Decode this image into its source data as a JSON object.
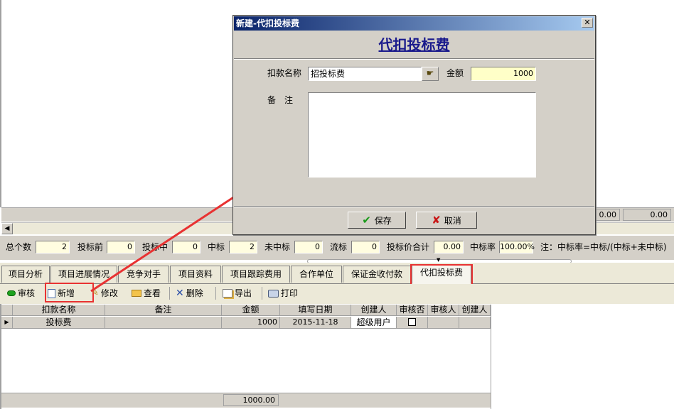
{
  "dialog": {
    "window_title": "新建-代扣投标费",
    "heading": "代扣投标费",
    "deduct_name_label": "扣款名称",
    "deduct_name_value": "招投标费",
    "amount_label": "金额",
    "amount_value": "1000",
    "note_label": "备　注",
    "note_value": "",
    "save_label": "保存",
    "cancel_label": "取消"
  },
  "background_panel": {
    "right_value_1": "0.00",
    "right_value_2": "0.00"
  },
  "stats": {
    "total_label": "总个数",
    "total_value": "2",
    "before_bid_label": "投标前",
    "before_bid_value": "0",
    "bidding_label": "投标中",
    "bidding_value": "0",
    "won_label": "中标",
    "won_value": "2",
    "lost_label": "未中标",
    "lost_value": "0",
    "failed_label": "流标",
    "failed_value": "0",
    "bid_price_total_label": "投标价合计",
    "bid_price_total_value": "0.00",
    "win_rate_label": "中标率",
    "win_rate_value": "100.00%",
    "note": "注：中标率=中标/(中标+未中标)"
  },
  "tabs": [
    "项目分析",
    "项目进展情况",
    "竞争对手",
    "项目资料",
    "项目跟踪费用",
    "合作单位",
    "保证金收付款",
    "代扣投标费"
  ],
  "active_tab": "代扣投标费",
  "toolbar": {
    "audit": "审核",
    "add": "新增",
    "edit": "修改",
    "view": "查看",
    "delete": "删除",
    "export": "导出",
    "print": "打印"
  },
  "table": {
    "columns": [
      "扣款名称",
      "备注",
      "金额",
      "填写日期",
      "创建人",
      "审核否",
      "审核人",
      "创建人"
    ],
    "rows": [
      {
        "name": "投标费",
        "note": "",
        "amount": "1000",
        "date": "2015-11-18",
        "creator": "超级用户",
        "audited": false,
        "auditor": "",
        "creator2": ""
      }
    ],
    "footer_total": "1000.00"
  },
  "colors": {
    "dialog_title_gradient_start": "#0a246a",
    "dialog_title_gradient_end": "#a6caf0",
    "heading": "#1a1a8c",
    "amount_bg": "#ffffc8",
    "highlight_red": "#e83232",
    "window_bg": "#d4d0c8"
  }
}
